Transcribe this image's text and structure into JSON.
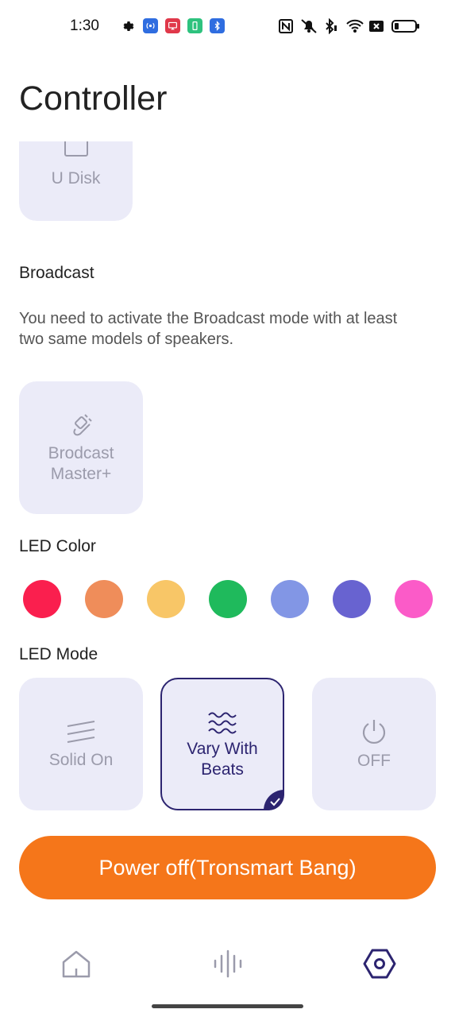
{
  "status_bar": {
    "time": "1:30"
  },
  "header": {
    "title": "Controller"
  },
  "source": {
    "u_disk_label": "U Disk"
  },
  "broadcast": {
    "title": "Broadcast",
    "description": "You need to activate the Broadcast mode with at least two same models of speakers.",
    "master_label_line1": "Brodcast",
    "master_label_line2": "Master+"
  },
  "led_color": {
    "title": "LED Color",
    "colors": [
      "#fa1f4e",
      "#ef8d5a",
      "#f8c667",
      "#1fba5c",
      "#8296e5",
      "#6863d0",
      "#fb5bc8"
    ]
  },
  "led_mode": {
    "title": "LED Mode",
    "solid_on": "Solid On",
    "vary_line1": "Vary With",
    "vary_line2": "Beats",
    "off": "OFF",
    "selected": "Vary With Beats"
  },
  "power_off": {
    "label": "Power off(Tronsmart Bang)"
  },
  "colors": {
    "accent": "#2c2470",
    "power_button": "#f5761a",
    "card_bg": "#ebebf8",
    "muted_text": "#9b9bab"
  },
  "bottom_nav": {
    "items": [
      "home-icon",
      "equalizer-icon",
      "settings-icon"
    ],
    "active": "settings-icon"
  }
}
